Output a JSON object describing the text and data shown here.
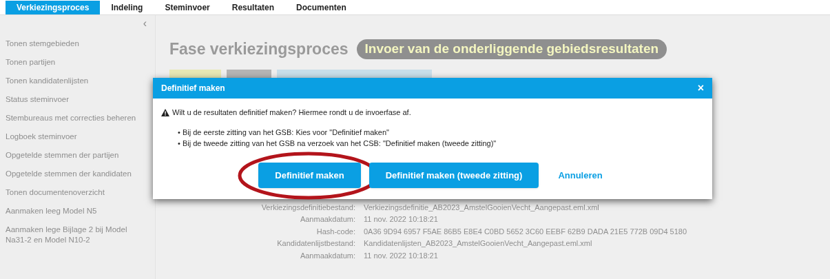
{
  "tabs": [
    {
      "label": "Verkiezingsproces",
      "selected": true
    },
    {
      "label": "Indeling",
      "selected": false
    },
    {
      "label": "Steminvoer",
      "selected": false
    },
    {
      "label": "Resultaten",
      "selected": false
    },
    {
      "label": "Documenten",
      "selected": false
    }
  ],
  "sidebar": {
    "collapse": "‹",
    "items": [
      "Tonen stemgebieden",
      "Tonen partijen",
      "Tonen kandidatenlijsten",
      "Status steminvoer",
      "Stembureaus met correcties beheren",
      "Logboek steminvoer",
      "Opgetelde stemmen der partijen",
      "Opgetelde stemmen der kandidaten",
      "Tonen documentenoverzicht",
      "Aanmaken leeg Model N5",
      "Aanmaken lege Bijlage 2 bij Model Na31-2 en Model N10-2"
    ]
  },
  "page": {
    "title": "Fase verkiezingsproces",
    "phase": "Invoer van de onderliggende gebiedsresultaten",
    "details": [
      {
        "label": "Verkiezingsdefinitiebestand:",
        "value": "Verkiezingsdefinitie_AB2023_AmstelGooienVecht_Aangepast.eml.xml"
      },
      {
        "label": "Aanmaakdatum:",
        "value": "11 nov. 2022 10:18:21"
      },
      {
        "label": "Hash-code:",
        "value": "0A36 9D94 6957 F5AE 86B5 E8E4 C0BD 5652 3C60 EEBF 62B9 DADA 21E5 772B 09D4 5180"
      },
      {
        "label": "Kandidatenlijstbestand:",
        "value": "Kandidatenlijsten_AB2023_AmstelGooienVecht_Aangepast.eml.xml"
      },
      {
        "label": "Aanmaakdatum:",
        "value": "11 nov. 2022 10:18:21"
      }
    ]
  },
  "dialog": {
    "title": "Definitief maken",
    "close": "×",
    "message": "Wilt u de resultaten definitief maken? Hiermee rondt u de invoerfase af.",
    "bullets": [
      "• Bij de eerste zitting van het GSB: Kies voor \"Definitief maken\"",
      "• Bij de tweede zitting van het GSB na verzoek van het CSB: \"Definitief maken (tweede zitting)\""
    ],
    "buttons": [
      {
        "label": "Definitief maken",
        "kind": "primary",
        "highlighted": true
      },
      {
        "label": "Definitief maken (tweede zitting)",
        "kind": "primary",
        "highlighted": false
      },
      {
        "label": "Annuleren",
        "kind": "link",
        "highlighted": false
      }
    ]
  }
}
